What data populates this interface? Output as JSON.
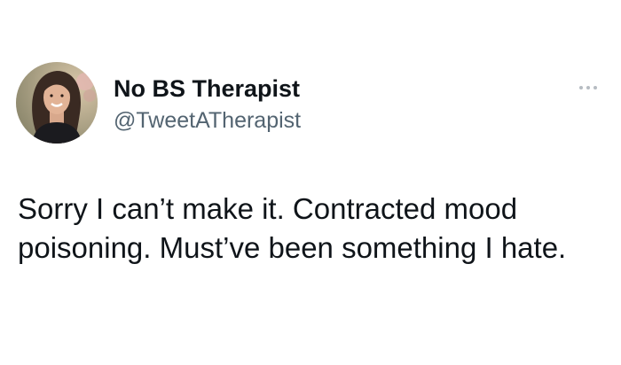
{
  "tweet": {
    "author": {
      "display_name": "No BS Therapist",
      "handle": "@TweetATherapist",
      "avatar_icon": "profile-photo"
    },
    "more_icon": "ellipsis-icon",
    "text": "Sorry I can’t make it. Contracted mood\npoisoning. Must’ve been something I hate."
  },
  "colors": {
    "text_primary": "#0f1419",
    "text_secondary": "#536471",
    "background": "#ffffff"
  }
}
